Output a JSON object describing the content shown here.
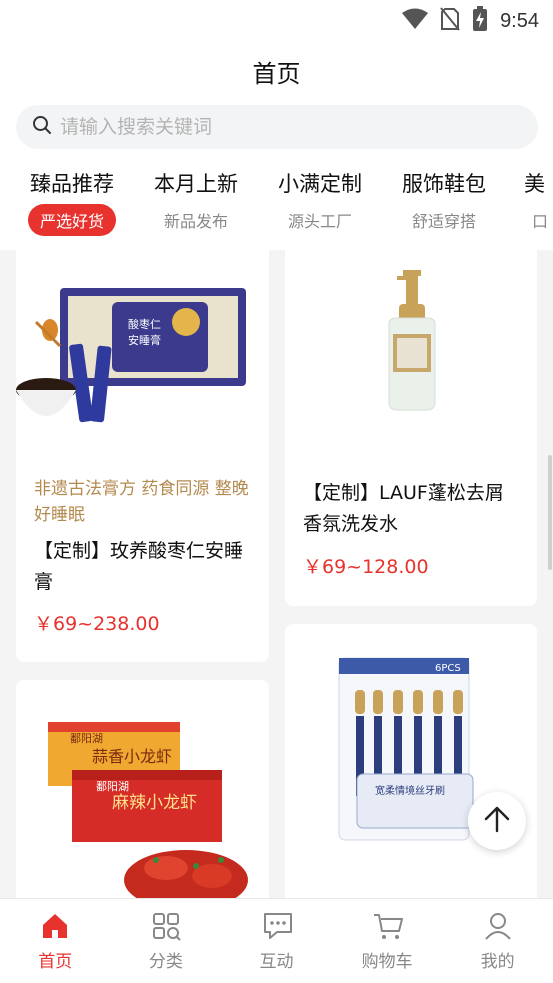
{
  "status_bar": {
    "time": "9:54",
    "icons": [
      "wifi-icon",
      "no-sim-icon",
      "battery-charging-icon"
    ]
  },
  "header": {
    "title": "首页"
  },
  "search": {
    "placeholder": "请输入搜索关键词"
  },
  "categories": [
    {
      "title": "臻品推荐",
      "subtitle": "严选好货",
      "active": true
    },
    {
      "title": "本月上新",
      "subtitle": "新品发布",
      "active": false
    },
    {
      "title": "小满定制",
      "subtitle": "源头工厂",
      "active": false
    },
    {
      "title": "服饰鞋包",
      "subtitle": "舒适穿搭",
      "active": false
    },
    {
      "title": "美",
      "subtitle": "口",
      "active": false
    }
  ],
  "products": [
    {
      "tag": "非遗古法膏方 药食同源 整晚好睡眠",
      "title": "【定制】玫养酸枣仁安睡膏",
      "price": "￥69~238.00",
      "image": "sleep-paste-box-image"
    },
    {
      "tag": "",
      "title": "【定制】LAUF蓬松去屑香氛洗发水",
      "price": "￥69~128.00",
      "image": "shampoo-bottle-image"
    },
    {
      "tag": "",
      "title": "",
      "price": "",
      "image": "crayfish-box-image",
      "box_brand": "鄱阳湖",
      "box_label_1": "蒜香小龙虾",
      "box_label_2": "麻辣小龙虾"
    },
    {
      "tag": "",
      "title": "",
      "price": "",
      "image": "toothbrush-pack-image",
      "pack_count": "6PCS",
      "pack_label": "宽柔情境丝牙刷"
    }
  ],
  "tab_bar": [
    {
      "label": "首页",
      "icon": "home-icon",
      "active": true
    },
    {
      "label": "分类",
      "icon": "category-icon",
      "active": false
    },
    {
      "label": "互动",
      "icon": "chat-icon",
      "active": false
    },
    {
      "label": "购物车",
      "icon": "cart-icon",
      "active": false
    },
    {
      "label": "我的",
      "icon": "user-icon",
      "active": false
    }
  ],
  "colors": {
    "accent": "#e8322e",
    "tag": "#b48a4f",
    "background": "#f4f4f4"
  }
}
